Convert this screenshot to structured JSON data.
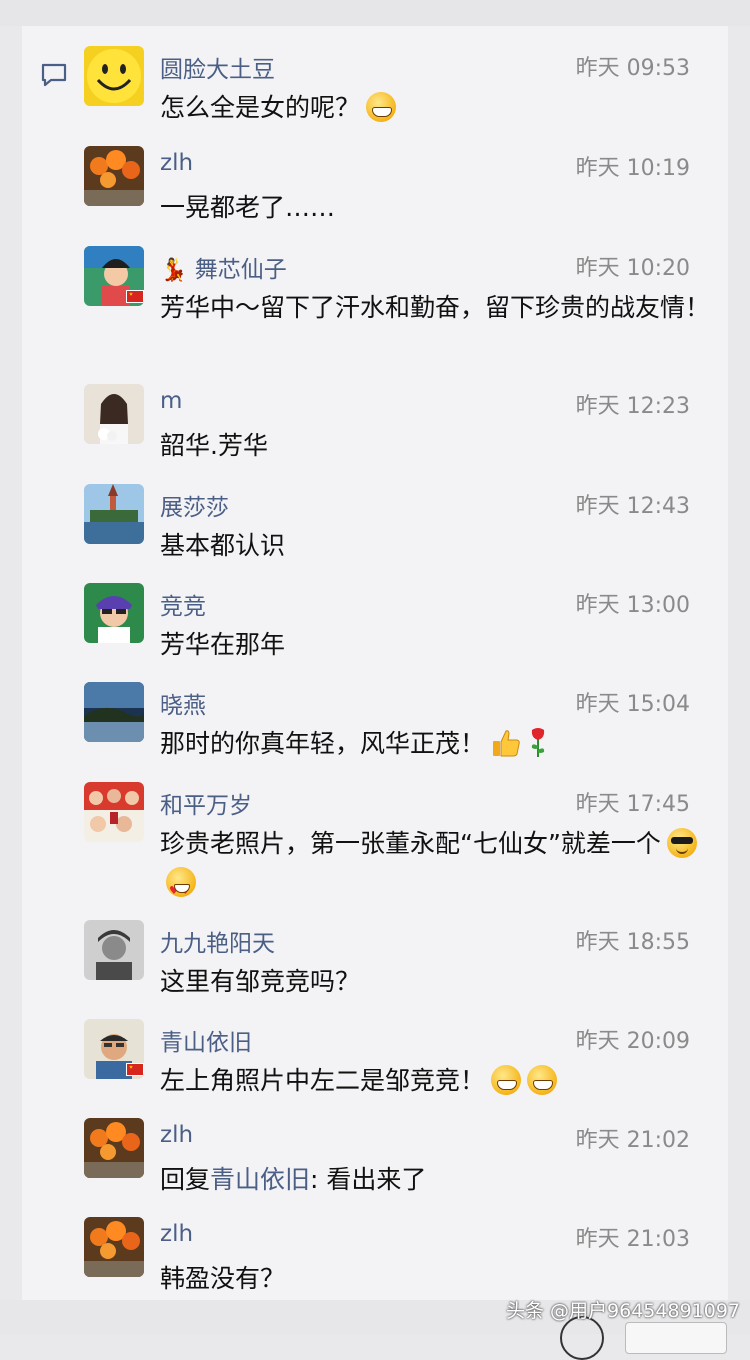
{
  "comments": [
    {
      "name": "圆脸大土豆",
      "time": "昨天 09:53",
      "text": "怎么全是女的呢？",
      "emojis": [
        "grin"
      ]
    },
    {
      "name": "zlh",
      "time": "昨天 10:19",
      "text": "一晃都老了……"
    },
    {
      "name": "舞芯仙子",
      "time": "昨天 10:20",
      "text": "芳华中～留下了汗水和勤奋，留下珍贵的战友情！"
    },
    {
      "name": "m",
      "time": "昨天 12:23",
      "text": "韶华.芳华"
    },
    {
      "name": "展莎莎",
      "time": "昨天 12:43",
      "text": "基本都认识"
    },
    {
      "name": "竞竞",
      "time": "昨天 13:00",
      "text": "芳华在那年"
    },
    {
      "name": "晓燕",
      "time": "昨天 15:04",
      "text": "那时的你真年轻，风华正茂！",
      "emojis": [
        "thumbs-up",
        "rose"
      ]
    },
    {
      "name": "和平万岁",
      "time": "昨天 17:45",
      "text": "珍贵老照片，第一张董永配“七仙女”就差一个",
      "emojis": [
        "cool",
        "heart-eyes"
      ]
    },
    {
      "name": "九九艳阳天",
      "time": "昨天 18:55",
      "text": "这里有邹竞竞吗？"
    },
    {
      "name": "青山依旧",
      "time": "昨天 20:09",
      "text": "左上角照片中左二是邹竞竞！",
      "emojis": [
        "grin",
        "grin"
      ]
    },
    {
      "name": "zlh",
      "time": "昨天 21:02",
      "reply_prefix": "回复",
      "reply_to": "青山依旧",
      "text": ": 看出来了"
    },
    {
      "name": "zlh",
      "time": "昨天 21:03",
      "text": "韩盈没有？"
    }
  ],
  "watermark": "头条 @用户96454891097",
  "colors": {
    "name": "#4b5f86",
    "time": "#8a8a8a",
    "text": "#111111",
    "panel": "#f3f3f5"
  }
}
